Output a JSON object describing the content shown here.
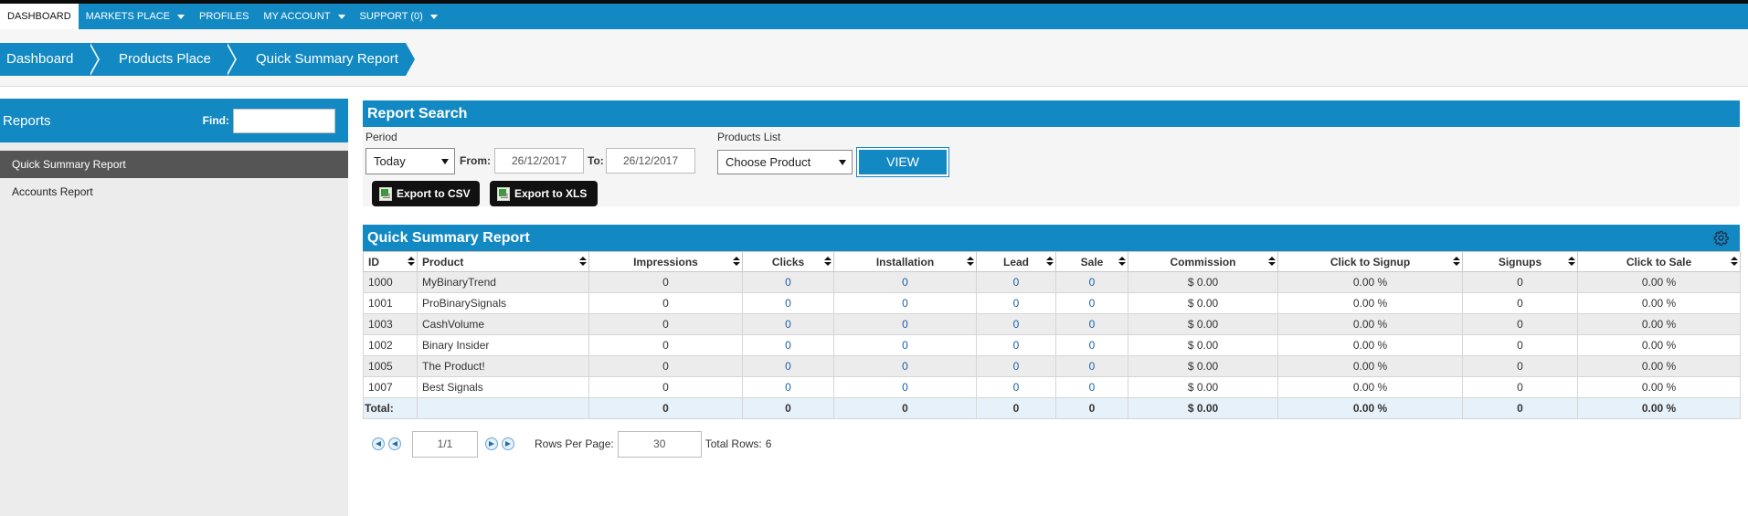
{
  "nav": {
    "items": [
      {
        "label": "DASHBOARD",
        "active": true,
        "dropdown": false
      },
      {
        "label": "MARKETS PLACE",
        "active": false,
        "dropdown": true
      },
      {
        "label": "PROFILES",
        "active": false,
        "dropdown": false
      },
      {
        "label": "MY ACCOUNT",
        "active": false,
        "dropdown": true
      },
      {
        "label": "SUPPORT (0)",
        "active": false,
        "dropdown": true
      }
    ]
  },
  "breadcrumb": [
    "Dashboard",
    "Products Place",
    "Quick Summary Report"
  ],
  "sidebar": {
    "title": "Reports",
    "find_label": "Find:",
    "find_value": "",
    "items": [
      {
        "label": "Quick Summary Report",
        "active": true
      },
      {
        "label": "Accounts Report",
        "active": false
      }
    ]
  },
  "report_search": {
    "title": "Report Search",
    "period_label": "Period",
    "period_value": "Today",
    "from_label": "From:",
    "from_value": "26/12/2017",
    "to_label": "To:",
    "to_value": "26/12/2017",
    "products_label": "Products List",
    "products_value": "Choose Product",
    "view_label": "VIEW",
    "export_csv_label": "Export to CSV",
    "export_xls_label": "Export to XLS"
  },
  "summary": {
    "title": "Quick Summary Report",
    "columns": [
      "ID",
      "Product",
      "Impressions",
      "Clicks",
      "Installation",
      "Lead",
      "Sale",
      "Commission",
      "Click to Signup",
      "Signups",
      "Click to Sale"
    ],
    "rows": [
      [
        "1000",
        "MyBinaryTrend",
        "0",
        "0",
        "0",
        "0",
        "0",
        "$ 0.00",
        "0.00 %",
        "0",
        "0.00 %"
      ],
      [
        "1001",
        "ProBinarySignals",
        "0",
        "0",
        "0",
        "0",
        "0",
        "$ 0.00",
        "0.00 %",
        "0",
        "0.00 %"
      ],
      [
        "1003",
        "CashVolume",
        "0",
        "0",
        "0",
        "0",
        "0",
        "$ 0.00",
        "0.00 %",
        "0",
        "0.00 %"
      ],
      [
        "1002",
        "Binary Insider",
        "0",
        "0",
        "0",
        "0",
        "0",
        "$ 0.00",
        "0.00 %",
        "0",
        "0.00 %"
      ],
      [
        "1005",
        "The Product!",
        "0",
        "0",
        "0",
        "0",
        "0",
        "$ 0.00",
        "0.00 %",
        "0",
        "0.00 %"
      ],
      [
        "1007",
        "Best Signals",
        "0",
        "0",
        "0",
        "0",
        "0",
        "$ 0.00",
        "0.00 %",
        "0",
        "0.00 %"
      ]
    ],
    "total": [
      "Total:",
      "",
      "0",
      "0",
      "0",
      "0",
      "0",
      "$ 0.00",
      "0.00 %",
      "0",
      "0.00 %"
    ]
  },
  "pager": {
    "page_value": "1/1",
    "rows_per_page_label": "Rows Per Page:",
    "rows_per_page_value": "30",
    "total_rows_label": "Total Rows:",
    "total_rows_value": "6"
  },
  "colors": {
    "accent": "#1389c4",
    "active_sidebar": "#555555",
    "total_row": "#e6f1fa"
  }
}
